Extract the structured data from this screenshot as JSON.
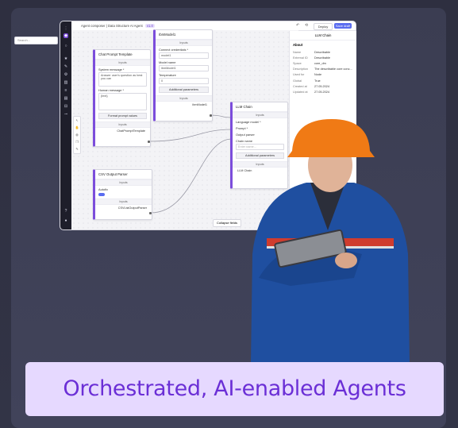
{
  "colors": {
    "accent": "#7c4ddb",
    "brand_text": "#6b2fd6",
    "banner_bg": "#e6d9ff",
    "save_btn": "#5a6cf0",
    "background": "#3b3d52"
  },
  "header": {
    "crumb": "Agent composer",
    "sep": "|",
    "title": "Data Structure AI Agent",
    "version": "v1.0",
    "deploy": "Deploy",
    "save": "Save draft"
  },
  "canvas": {
    "search_placeholder": "Search...",
    "collapse": "Collapse fields"
  },
  "node_chat": {
    "title": "Chat Prompt Template",
    "inputs": "Inputs",
    "sys_label": "System message *",
    "sys_value": "Answer user's question as best you can",
    "human_label": "Human message *",
    "human_value": "{text}",
    "format_btn": "Format prompt values",
    "outputs": "Inputs",
    "output": "ChatPromptTemplate"
  },
  "node_llm": {
    "title": "IbmModel1",
    "inputs": "Inputs",
    "conn_label": "Connect credentials *",
    "conn_value": "model1",
    "model_label": "Model name",
    "model_value": "ibmModel1",
    "temp_label": "Temperature",
    "temp_value": "0",
    "add_params": "Additional parameters",
    "outputs": "Inputs",
    "output": "ibmModel1"
  },
  "node_chain": {
    "title": "LLM Chain",
    "inputs": "Inputs",
    "f1": "Language model *",
    "f2": "Prompt *",
    "f3": "Output parser",
    "f4": "Chain name",
    "f4_placeholder": "Enter name...",
    "add_params": "Additional parameters",
    "outputs": "Inputs",
    "output": "LLM Chain"
  },
  "node_csv": {
    "title": "CSV Output Parser",
    "inputs": "Inputs",
    "autofix": "Autofix",
    "outputs": "Inputs",
    "output": "CSVListOutputParser"
  },
  "panel": {
    "title": "LLM Chain",
    "about": "About",
    "rows": [
      {
        "k": "Name",
        "v": "Describable"
      },
      {
        "k": "External ID",
        "v": "Describable"
      },
      {
        "k": "Space",
        "v": "core_dm"
      },
      {
        "k": "Description",
        "v": "The describable core conc..."
      },
      {
        "k": "Used for",
        "v": "Node"
      },
      {
        "k": "Global",
        "v": "True"
      },
      {
        "k": "Created at",
        "v": "27.05.2024"
      },
      {
        "k": "Updated at",
        "v": "27.05.2024"
      }
    ]
  },
  "banner": {
    "text": "Orchestrated, AI-enabled Agents"
  }
}
